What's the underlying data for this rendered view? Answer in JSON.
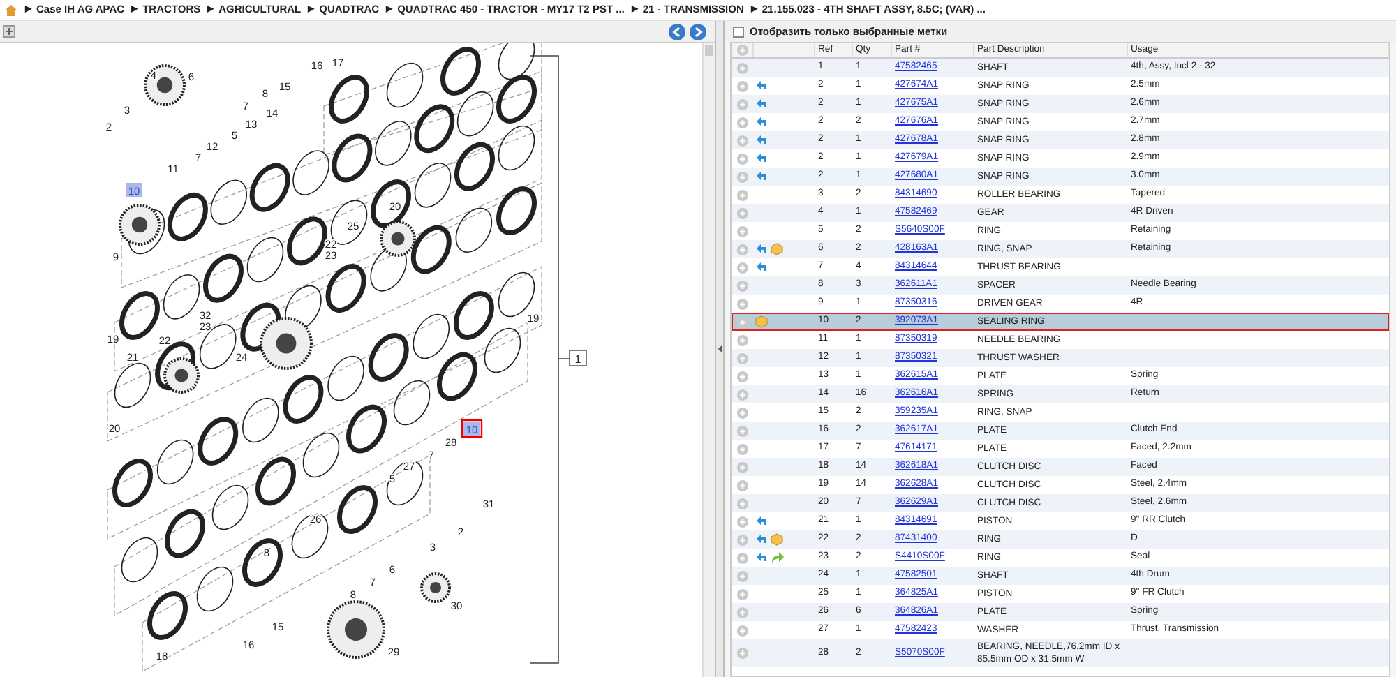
{
  "breadcrumb": {
    "separator": "▶",
    "items": [
      "Case IH AG APAC",
      "TRACTORS",
      "AGRICULTURAL",
      "QUADTRAC",
      "QUADTRAC 450 - TRACTOR - MY17 T2 PST ...",
      "21 - TRANSMISSION",
      "21.155.023 - 4TH SHAFT ASSY, 8.5C; (VAR) ..."
    ]
  },
  "diagram": {
    "assembly_label": "1",
    "callouts": [
      {
        "label": "16",
        "highlighted": false,
        "selected": false
      },
      {
        "label": "17",
        "highlighted": false,
        "selected": false
      },
      {
        "label": "4",
        "highlighted": false,
        "selected": false
      },
      {
        "label": "6",
        "highlighted": false,
        "selected": false
      },
      {
        "label": "15",
        "highlighted": false,
        "selected": false
      },
      {
        "label": "8",
        "highlighted": false,
        "selected": false
      },
      {
        "label": "3",
        "highlighted": false,
        "selected": false
      },
      {
        "label": "7",
        "highlighted": false,
        "selected": false
      },
      {
        "label": "14",
        "highlighted": false,
        "selected": false
      },
      {
        "label": "2",
        "highlighted": false,
        "selected": false
      },
      {
        "label": "13",
        "highlighted": false,
        "selected": false
      },
      {
        "label": "5",
        "highlighted": false,
        "selected": false
      },
      {
        "label": "12",
        "highlighted": false,
        "selected": false
      },
      {
        "label": "7",
        "highlighted": false,
        "selected": false
      },
      {
        "label": "11",
        "highlighted": false,
        "selected": false
      },
      {
        "label": "10",
        "highlighted": true,
        "selected": false
      },
      {
        "label": "20",
        "highlighted": false,
        "selected": false
      },
      {
        "label": "25",
        "highlighted": false,
        "selected": false
      },
      {
        "label": "22",
        "highlighted": false,
        "selected": false
      },
      {
        "label": "9",
        "highlighted": false,
        "selected": false
      },
      {
        "label": "23",
        "highlighted": false,
        "selected": false
      },
      {
        "label": "32",
        "highlighted": false,
        "selected": false
      },
      {
        "label": "19",
        "highlighted": false,
        "selected": false
      },
      {
        "label": "23",
        "highlighted": false,
        "selected": false
      },
      {
        "label": "19",
        "highlighted": false,
        "selected": false
      },
      {
        "label": "22",
        "highlighted": false,
        "selected": false
      },
      {
        "label": "21",
        "highlighted": false,
        "selected": false
      },
      {
        "label": "24",
        "highlighted": false,
        "selected": false
      },
      {
        "label": "20",
        "highlighted": false,
        "selected": false
      },
      {
        "label": "10",
        "highlighted": true,
        "selected": true
      },
      {
        "label": "28",
        "highlighted": false,
        "selected": false
      },
      {
        "label": "7",
        "highlighted": false,
        "selected": false
      },
      {
        "label": "27",
        "highlighted": false,
        "selected": false
      },
      {
        "label": "5",
        "highlighted": false,
        "selected": false
      },
      {
        "label": "31",
        "highlighted": false,
        "selected": false
      },
      {
        "label": "26",
        "highlighted": false,
        "selected": false
      },
      {
        "label": "2",
        "highlighted": false,
        "selected": false
      },
      {
        "label": "8",
        "highlighted": false,
        "selected": false
      },
      {
        "label": "3",
        "highlighted": false,
        "selected": false
      },
      {
        "label": "6",
        "highlighted": false,
        "selected": false
      },
      {
        "label": "7",
        "highlighted": false,
        "selected": false
      },
      {
        "label": "8",
        "highlighted": false,
        "selected": false
      },
      {
        "label": "30",
        "highlighted": false,
        "selected": false
      },
      {
        "label": "15",
        "highlighted": false,
        "selected": false
      },
      {
        "label": "16",
        "highlighted": false,
        "selected": false
      },
      {
        "label": "18",
        "highlighted": false,
        "selected": false
      },
      {
        "label": "29",
        "highlighted": false,
        "selected": false
      }
    ]
  },
  "filter": {
    "label": "Отобразить только выбранные метки",
    "checked": false
  },
  "table": {
    "columns": [
      "Ref",
      "Qty",
      "Part #",
      "Part Description",
      "Usage"
    ],
    "rows": [
      {
        "alternate": false,
        "in_kit": false,
        "superseded": false,
        "selected": false,
        "ref": "1",
        "qty": "1",
        "part": "47582465",
        "description": "SHAFT",
        "usage": "4th, Assy, Incl 2 - 32"
      },
      {
        "alternate": true,
        "in_kit": false,
        "superseded": false,
        "selected": false,
        "ref": "2",
        "qty": "1",
        "part": "427674A1",
        "description": "SNAP RING",
        "usage": "2.5mm"
      },
      {
        "alternate": true,
        "in_kit": false,
        "superseded": false,
        "selected": false,
        "ref": "2",
        "qty": "1",
        "part": "427675A1",
        "description": "SNAP RING",
        "usage": "2.6mm"
      },
      {
        "alternate": true,
        "in_kit": false,
        "superseded": false,
        "selected": false,
        "ref": "2",
        "qty": "2",
        "part": "427676A1",
        "description": "SNAP RING",
        "usage": "2.7mm"
      },
      {
        "alternate": true,
        "in_kit": false,
        "superseded": false,
        "selected": false,
        "ref": "2",
        "qty": "1",
        "part": "427678A1",
        "description": "SNAP RING",
        "usage": "2.8mm"
      },
      {
        "alternate": true,
        "in_kit": false,
        "superseded": false,
        "selected": false,
        "ref": "2",
        "qty": "1",
        "part": "427679A1",
        "description": "SNAP RING",
        "usage": "2.9mm"
      },
      {
        "alternate": true,
        "in_kit": false,
        "superseded": false,
        "selected": false,
        "ref": "2",
        "qty": "1",
        "part": "427680A1",
        "description": "SNAP RING",
        "usage": "3.0mm"
      },
      {
        "alternate": false,
        "in_kit": false,
        "superseded": false,
        "selected": false,
        "ref": "3",
        "qty": "2",
        "part": "84314690",
        "description": "ROLLER BEARING",
        "usage": "Tapered"
      },
      {
        "alternate": false,
        "in_kit": false,
        "superseded": false,
        "selected": false,
        "ref": "4",
        "qty": "1",
        "part": "47582469",
        "description": "GEAR",
        "usage": "4R Driven"
      },
      {
        "alternate": false,
        "in_kit": false,
        "superseded": false,
        "selected": false,
        "ref": "5",
        "qty": "2",
        "part": "S5640S00F",
        "description": "RING",
        "usage": "Retaining"
      },
      {
        "alternate": true,
        "in_kit": true,
        "superseded": false,
        "selected": false,
        "ref": "6",
        "qty": "2",
        "part": "428163A1",
        "description": "RING, SNAP",
        "usage": "Retaining"
      },
      {
        "alternate": true,
        "in_kit": false,
        "superseded": false,
        "selected": false,
        "ref": "7",
        "qty": "4",
        "part": "84314644",
        "description": "THRUST BEARING"
      },
      {
        "alternate": false,
        "in_kit": false,
        "superseded": false,
        "selected": false,
        "ref": "8",
        "qty": "3",
        "part": "362611A1",
        "description": "SPACER",
        "usage": "Needle Bearing"
      },
      {
        "alternate": false,
        "in_kit": false,
        "superseded": false,
        "selected": false,
        "ref": "9",
        "qty": "1",
        "part": "87350316",
        "description": "DRIVEN GEAR",
        "usage": "4R"
      },
      {
        "alternate": false,
        "in_kit": true,
        "superseded": false,
        "selected": true,
        "ref": "10",
        "qty": "2",
        "part": "392073A1",
        "description": "SEALING RING"
      },
      {
        "alternate": false,
        "in_kit": false,
        "superseded": false,
        "selected": false,
        "ref": "11",
        "qty": "1",
        "part": "87350319",
        "description": "NEEDLE BEARING"
      },
      {
        "alternate": false,
        "in_kit": false,
        "superseded": false,
        "selected": false,
        "ref": "12",
        "qty": "1",
        "part": "87350321",
        "description": "THRUST WASHER"
      },
      {
        "alternate": false,
        "in_kit": false,
        "superseded": false,
        "selected": false,
        "ref": "13",
        "qty": "1",
        "part": "362615A1",
        "description": "PLATE",
        "usage": "Spring"
      },
      {
        "alternate": false,
        "in_kit": false,
        "superseded": false,
        "selected": false,
        "ref": "14",
        "qty": "16",
        "part": "362616A1",
        "description": "SPRING",
        "usage": "Return"
      },
      {
        "alternate": false,
        "in_kit": false,
        "superseded": false,
        "selected": false,
        "ref": "15",
        "qty": "2",
        "part": "359235A1",
        "description": "RING, SNAP"
      },
      {
        "alternate": false,
        "in_kit": false,
        "superseded": false,
        "selected": false,
        "ref": "16",
        "qty": "2",
        "part": "362617A1",
        "description": "PLATE",
        "usage": "Clutch End"
      },
      {
        "alternate": false,
        "in_kit": false,
        "superseded": false,
        "selected": false,
        "ref": "17",
        "qty": "7",
        "part": "47614171",
        "description": "PLATE",
        "usage": "Faced, 2.2mm"
      },
      {
        "alternate": false,
        "in_kit": false,
        "superseded": false,
        "selected": false,
        "ref": "18",
        "qty": "14",
        "part": "362618A1",
        "description": "CLUTCH DISC",
        "usage": "Faced"
      },
      {
        "alternate": false,
        "in_kit": false,
        "superseded": false,
        "selected": false,
        "ref": "19",
        "qty": "14",
        "part": "362628A1",
        "description": "CLUTCH DISC",
        "usage": "Steel, 2.4mm"
      },
      {
        "alternate": false,
        "in_kit": false,
        "superseded": false,
        "selected": false,
        "ref": "20",
        "qty": "7",
        "part": "362629A1",
        "description": "CLUTCH DISC",
        "usage": "Steel, 2.6mm"
      },
      {
        "alternate": true,
        "in_kit": false,
        "superseded": false,
        "selected": false,
        "ref": "21",
        "qty": "1",
        "part": "84314691",
        "description": "PISTON",
        "usage": "9\" RR Clutch"
      },
      {
        "alternate": true,
        "in_kit": true,
        "superseded": false,
        "selected": false,
        "ref": "22",
        "qty": "2",
        "part": "87431400",
        "description": "RING",
        "usage": "D"
      },
      {
        "alternate": true,
        "in_kit": false,
        "superseded": true,
        "selected": false,
        "ref": "23",
        "qty": "2",
        "part": "S4410S00F",
        "description": "RING",
        "usage": "Seal"
      },
      {
        "alternate": false,
        "in_kit": false,
        "superseded": false,
        "selected": false,
        "ref": "24",
        "qty": "1",
        "part": "47582501",
        "description": "SHAFT",
        "usage": "4th Drum"
      },
      {
        "alternate": false,
        "in_kit": false,
        "superseded": false,
        "selected": false,
        "ref": "25",
        "qty": "1",
        "part": "364825A1",
        "description": "PISTON",
        "usage": "9\" FR Clutch"
      },
      {
        "alternate": false,
        "in_kit": false,
        "superseded": false,
        "selected": false,
        "ref": "26",
        "qty": "6",
        "part": "364826A1",
        "description": "PLATE",
        "usage": "Spring"
      },
      {
        "alternate": false,
        "in_kit": false,
        "superseded": false,
        "selected": false,
        "ref": "27",
        "qty": "1",
        "part": "47582423",
        "description": "WASHER",
        "usage": "Thrust, Transmission"
      },
      {
        "alternate": false,
        "in_kit": false,
        "superseded": false,
        "selected": false,
        "ref": "28",
        "qty": "2",
        "part": "S5070S00F",
        "description": "BEARING, NEEDLE,76.2mm ID x 85.5mm OD x 31.5mm W"
      }
    ]
  }
}
